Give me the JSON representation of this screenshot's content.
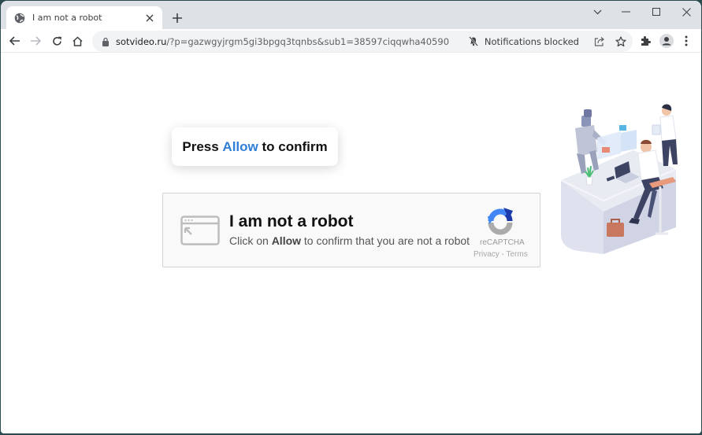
{
  "browser": {
    "tab": {
      "title": "I am not a robot",
      "favicon": "globe-icon"
    },
    "new_tab_label": "+",
    "window_controls": {
      "tab_search": "chevron-down-icon",
      "minimize": "minimize-icon",
      "maximize": "maximize-icon",
      "close": "close-icon"
    },
    "address_bar": {
      "domain": "sotvideo.ru",
      "path": "/?p=gazwgyjrgm5gi3bpgq3tqnbs&sub1=38597ciqqwha40590"
    },
    "notifications_status": "Notifications blocked"
  },
  "page": {
    "press_prompt": {
      "prefix": "Press ",
      "highlight": "Allow",
      "suffix": " to confirm"
    },
    "captcha": {
      "title": "I am not a robot",
      "subtitle_prefix": "Click on ",
      "subtitle_bold": "Allow",
      "subtitle_suffix": " to confirm that you are not a robot",
      "brand": "reCAPTCHA",
      "links": "Privacy - Terms"
    },
    "colors": {
      "allow_blue": "#2f7ed8",
      "recaptcha_blue_dark": "#1c3aa9",
      "recaptcha_blue_light": "#4285f4",
      "recaptcha_gray": "#ababab"
    }
  }
}
